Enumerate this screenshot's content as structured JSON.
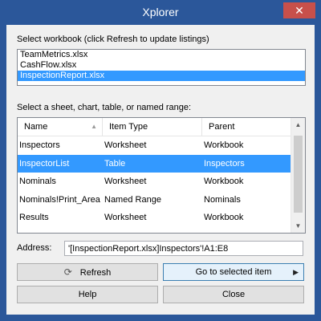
{
  "window": {
    "title": "Xplorer",
    "close_glyph": "✕"
  },
  "workbooks": {
    "label": "Select workbook (click Refresh to update listings)",
    "items": [
      {
        "label": "TeamMetrics.xlsx",
        "selected": false
      },
      {
        "label": "CashFlow.xlsx",
        "selected": false
      },
      {
        "label": "InspectionReport.xlsx",
        "selected": true
      }
    ]
  },
  "items": {
    "label": "Select a sheet, chart, table, or named range:",
    "columns": [
      "Name",
      "Item Type",
      "Parent"
    ],
    "sort_icon": "▲",
    "rows": [
      {
        "name": "Inspectors",
        "type": "Worksheet",
        "parent": "Workbook",
        "selected": false
      },
      {
        "name": "InspectorList",
        "type": "Table",
        "parent": "Inspectors",
        "selected": true
      },
      {
        "name": "Nominals",
        "type": "Worksheet",
        "parent": "Workbook",
        "selected": false
      },
      {
        "name": "Nominals!Print_Area",
        "type": "Named Range",
        "parent": "Nominals",
        "selected": false
      },
      {
        "name": "Results",
        "type": "Worksheet",
        "parent": "Workbook",
        "selected": false
      }
    ],
    "scroll_up": "▲",
    "scroll_down": "▼"
  },
  "address": {
    "label": "Address:",
    "value": "'[InspectionReport.xlsx]Inspectors'!A1:E8"
  },
  "buttons": {
    "refresh": {
      "label": "Refresh",
      "icon": "refresh-icon",
      "glyph": "⟳"
    },
    "goto": {
      "label": "Go to selected item",
      "glyph": "▶"
    },
    "help": {
      "label": "Help"
    },
    "close": {
      "label": "Close"
    }
  },
  "colors": {
    "title_bar": "#2b579a",
    "selection": "#3399ff",
    "close_button": "#c7504b"
  }
}
